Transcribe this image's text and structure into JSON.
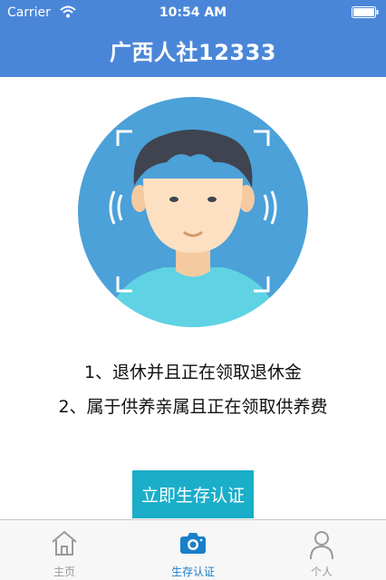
{
  "status_bar": {
    "carrier": "Carrier",
    "time": "10:54 AM",
    "icons": [
      "wifi-icon",
      "battery-icon"
    ]
  },
  "nav": {
    "title": "广西人社12333"
  },
  "hero": {
    "icon": "face-recognition-avatar-icon"
  },
  "requirements": [
    "1、退休并且正在领取退休金",
    "2、属于供养亲属且正在领取供养费"
  ],
  "action": {
    "button_label": "立即生存认证",
    "color": "#1aaec9"
  },
  "tabs": [
    {
      "label": "主页",
      "icon": "home-icon",
      "active": false
    },
    {
      "label": "生存认证",
      "icon": "camera-icon",
      "active": true
    },
    {
      "label": "个人",
      "icon": "person-icon",
      "active": false
    }
  ],
  "colors": {
    "header": "#4a86d8",
    "accent": "#1aaec9",
    "tab_active": "#1a7fc9",
    "tab_inactive": "#999999"
  }
}
